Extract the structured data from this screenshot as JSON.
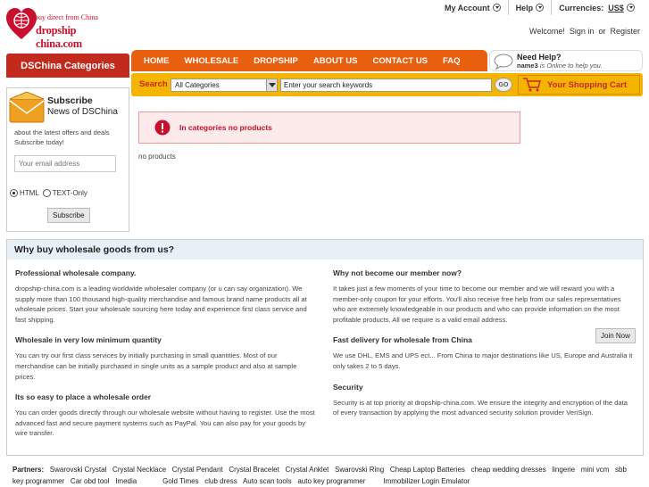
{
  "header": {
    "my_account": "My Account",
    "help": "Help",
    "currencies_label": "Currencies:",
    "currency_value": "US$",
    "welcome": "Welcome!",
    "sign_in": "Sign in",
    "or": "or",
    "register": "Register"
  },
  "logo": {
    "tagline": "buy direct from China",
    "name": "dropship china.com"
  },
  "sidebar": {
    "categories_title": "DSChina Categories"
  },
  "nav": {
    "items": [
      "HOME",
      "WHOLESALE",
      "DROPSHIP",
      "ABOUT US",
      "CONTACT US",
      "FAQ"
    ]
  },
  "help_box": {
    "title": "Need Help?",
    "agent": "name3",
    "status": "is Online to help you."
  },
  "search": {
    "label": "Search",
    "category": "All Categories",
    "placeholder": "Enter your search keywords",
    "go": "GO",
    "cart": "Your Shopping Cart"
  },
  "newsletter": {
    "title1": "Subscribe",
    "title2": "News of DSChina",
    "desc": "about the latest offers and deals Subscribe today!",
    "email_placeholder": "Your email address",
    "opt_html": "HTML",
    "opt_text": "TEXT-Only",
    "subscribe": "Subscribe"
  },
  "main": {
    "alert": "In categories no products",
    "note": "no products"
  },
  "why": {
    "title": "Why buy wholesale goods from us?",
    "left": [
      {
        "h": "Professional wholesale company.",
        "p": "dropship-china.com is a leading worldwide wholesaler company (or u can say organization). We supply more than 100 thousand high-quality merchandise and famous brand name products all at wholesale prices. Start your wholesale sourcing here today and experience first class service and fast shipping."
      },
      {
        "h": "Wholesale in very low minimum quantity",
        "p": "You can try our first class services by initially purchasing in small quantities. Most of our merchandise can be initially purchased in single units as a sample product and also at sample prices."
      },
      {
        "h": "Its so easy to place a wholesale order",
        "p": "You can order goods directly through our wholesale website without having to register. Use the most advanced fast and secure payment systems such as PayPal. You can also pay for your goods by wire transfer."
      }
    ],
    "right": [
      {
        "h": "Why not become our member now?",
        "p": "It takes just a few moments of your time to become our member and we will reward you with a member-only coupon for your efforts. You'll also receive free help from our sales representatives who are extremely knowledgeable in our products and who can provide information on the most profitable products. All we require is a valid email address."
      },
      {
        "h": "Fast delivery for wholesale from China",
        "p": "We use DHL, EMS and UPS ect... From China to major destinations like US, Europe and Australia it only takes 2 to 5 days."
      },
      {
        "h": "Security",
        "p": "Security is at top priority at dropship-china.com. We ensure the integrity and encryption of the data of every transaction by applying the most advanced security solution provider VeriSign."
      }
    ],
    "join_now": "Join Now"
  },
  "partners": {
    "label": "Partners:",
    "links": [
      "Swarovski Crystal",
      "Crystal Necklace",
      "Crystal Pendant",
      "Crystal Bracelet",
      "Crystal Anklet",
      "Swarovski Ring",
      "Cheap Laptop Batteries",
      "cheap wedding dresses",
      "lingerie",
      "mini vcm",
      "sbb key programmer",
      "Car obd tool",
      "Imedia",
      "Gold Times",
      "club dress",
      "Auto scan tools",
      "auto key programmer",
      "Immobilizer Login Emulator"
    ]
  },
  "colors": {
    "accent": "#e85f10",
    "brand_red": "#c32a1e",
    "search_yellow": "#f5b400"
  }
}
